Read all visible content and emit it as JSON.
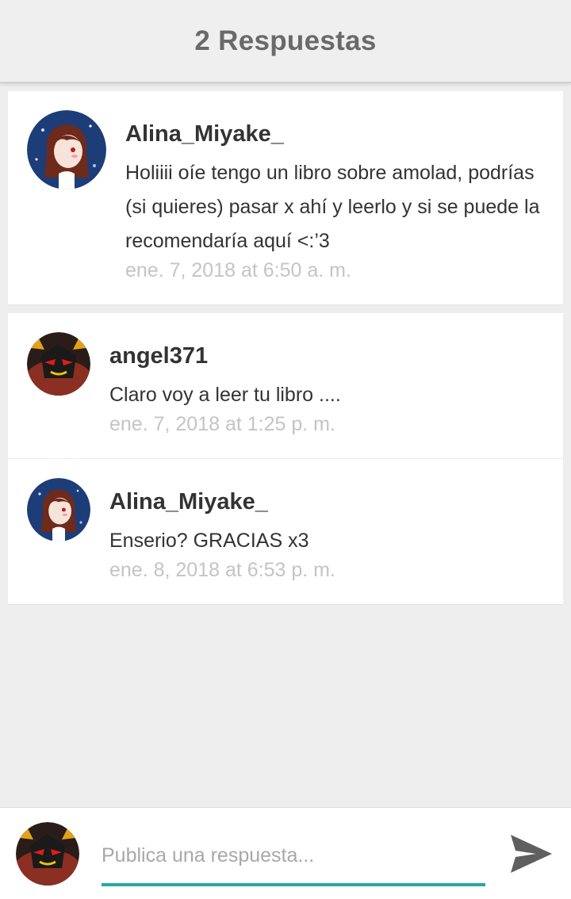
{
  "header": {
    "title": "2 Respuestas"
  },
  "main_comment": {
    "author": "Alina_Miyake_",
    "text": "Holiiii oíe tengo un libro sobre amolad, podrías (si quieres) pasar x ahí y leerlo y si se puede la recomendaría aquí <:’3",
    "timestamp": "ene. 7, 2018 at 6:50 a. m.",
    "avatar_icon": "girl-avatar-icon"
  },
  "replies": [
    {
      "author": "angel371",
      "text": "Claro voy a leer tu libro ....",
      "timestamp": "ene. 7, 2018 at 1:25 p. m.",
      "avatar_icon": "villain-avatar-icon"
    },
    {
      "author": "Alina_Miyake_",
      "text": "Enserio? GRACIAS x3",
      "timestamp": "ene. 8, 2018 at 6:53 p. m.",
      "avatar_icon": "girl-avatar-icon"
    }
  ],
  "composer": {
    "placeholder": "Publica una respuesta...",
    "value": "",
    "avatar_icon": "villain-avatar-icon",
    "send_icon": "send-icon",
    "accent_color": "#27a9a2"
  }
}
